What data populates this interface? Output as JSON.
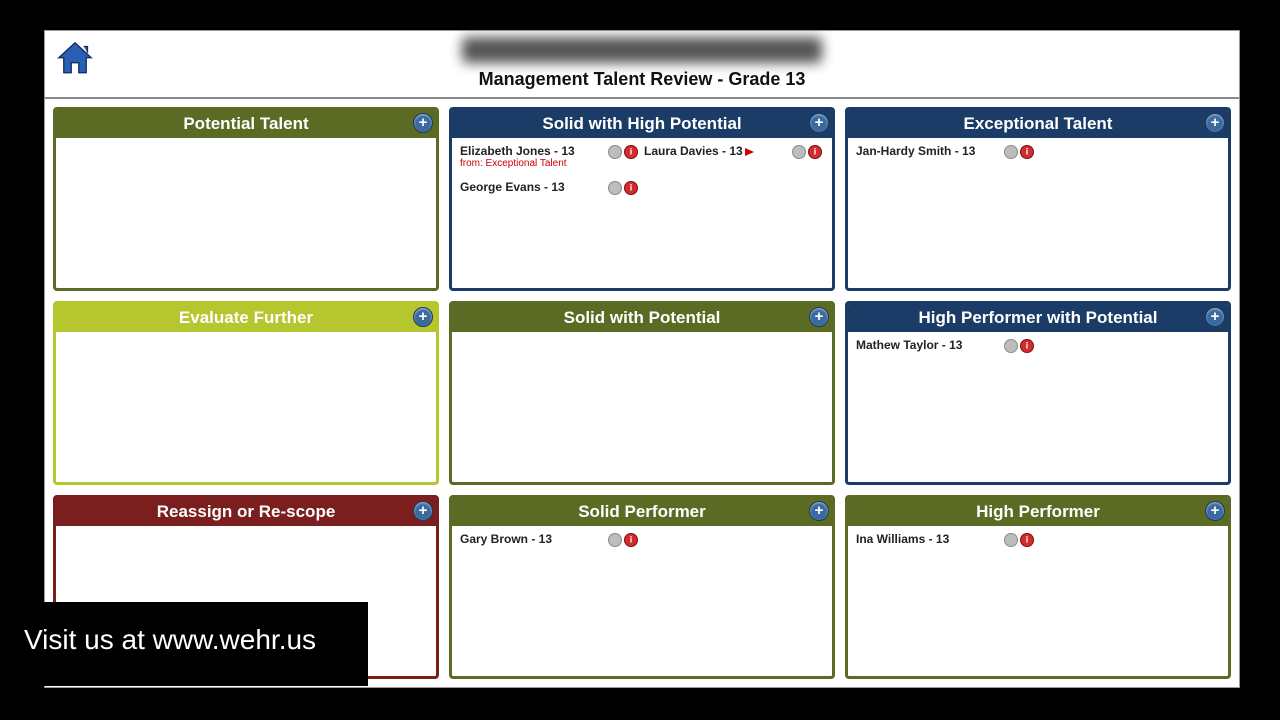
{
  "header": {
    "title": "Management Talent Review - Grade 13"
  },
  "grid": {
    "cells": [
      {
        "title": "Potential Talent",
        "theme": "olive",
        "people": []
      },
      {
        "title": "Solid with High Potential",
        "theme": "navy",
        "people": [
          {
            "name": "Elizabeth Jones - 13",
            "from": "from: Exceptional Talent",
            "flag": false
          },
          {
            "name": "Laura Davies - 13",
            "from": "",
            "flag": true
          },
          {
            "name": "George Evans - 13",
            "from": "",
            "flag": false
          }
        ]
      },
      {
        "title": "Exceptional Talent",
        "theme": "navy",
        "people": [
          {
            "name": "Jan-Hardy Smith - 13",
            "from": "",
            "flag": false
          }
        ]
      },
      {
        "title": "Evaluate Further",
        "theme": "lime",
        "people": []
      },
      {
        "title": "Solid with Potential",
        "theme": "olive",
        "people": []
      },
      {
        "title": "High Performer with Potential",
        "theme": "navy",
        "people": [
          {
            "name": "Mathew Taylor - 13",
            "from": "",
            "flag": false
          }
        ]
      },
      {
        "title": "Reassign or Re-scope",
        "theme": "maroon",
        "people": []
      },
      {
        "title": "Solid Performer",
        "theme": "olive",
        "people": [
          {
            "name": "Gary Brown - 13",
            "from": "",
            "flag": false
          }
        ]
      },
      {
        "title": "High Performer",
        "theme": "olive",
        "people": [
          {
            "name": "Ina Williams - 13",
            "from": "",
            "flag": false
          }
        ]
      }
    ]
  },
  "overlay": {
    "text": "Visit us at www.wehr.us"
  }
}
